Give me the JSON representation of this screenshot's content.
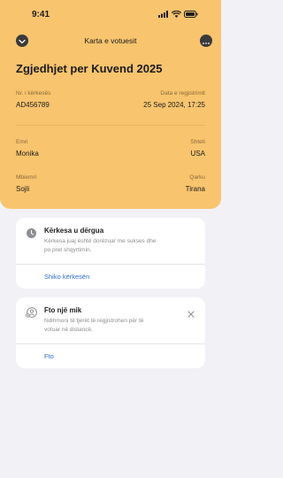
{
  "status_bar": {
    "time": "9:41"
  },
  "nav": {
    "title": "Karta e votuesit"
  },
  "page_title": "Zgjedhjet per Kuvend 2025",
  "fields": {
    "request_no": {
      "label": "Nr. i kërkesës",
      "value": "AD456789"
    },
    "registration_date": {
      "label": "Data e regjistrimit",
      "value": "25 Sep 2024, 17:25"
    },
    "first_name": {
      "label": "Emri",
      "value": "Monika"
    },
    "country": {
      "label": "Shteti",
      "value": "USA"
    },
    "last_name": {
      "label": "Mbiemri",
      "value": "Sojli"
    },
    "district": {
      "label": "Qarku",
      "value": "Tirana"
    }
  },
  "request_card": {
    "title": "Kërkesa u dërgua",
    "text_line1": "Kërkesa juaj është dorëzuar me sukses dhe",
    "text_line2": "po pret shqyrtimin.",
    "link": "Shiko kërkesën"
  },
  "photo_card": {
    "title": "Fto një mik",
    "text_line1": "Ndihmoni të tjerët të regjistrohen për të",
    "text_line2": "votuar në distancë.",
    "link": "Fto"
  },
  "colors": {
    "header": "#f8c46d",
    "background": "#f2f1f6",
    "link": "#2f6fd6"
  }
}
